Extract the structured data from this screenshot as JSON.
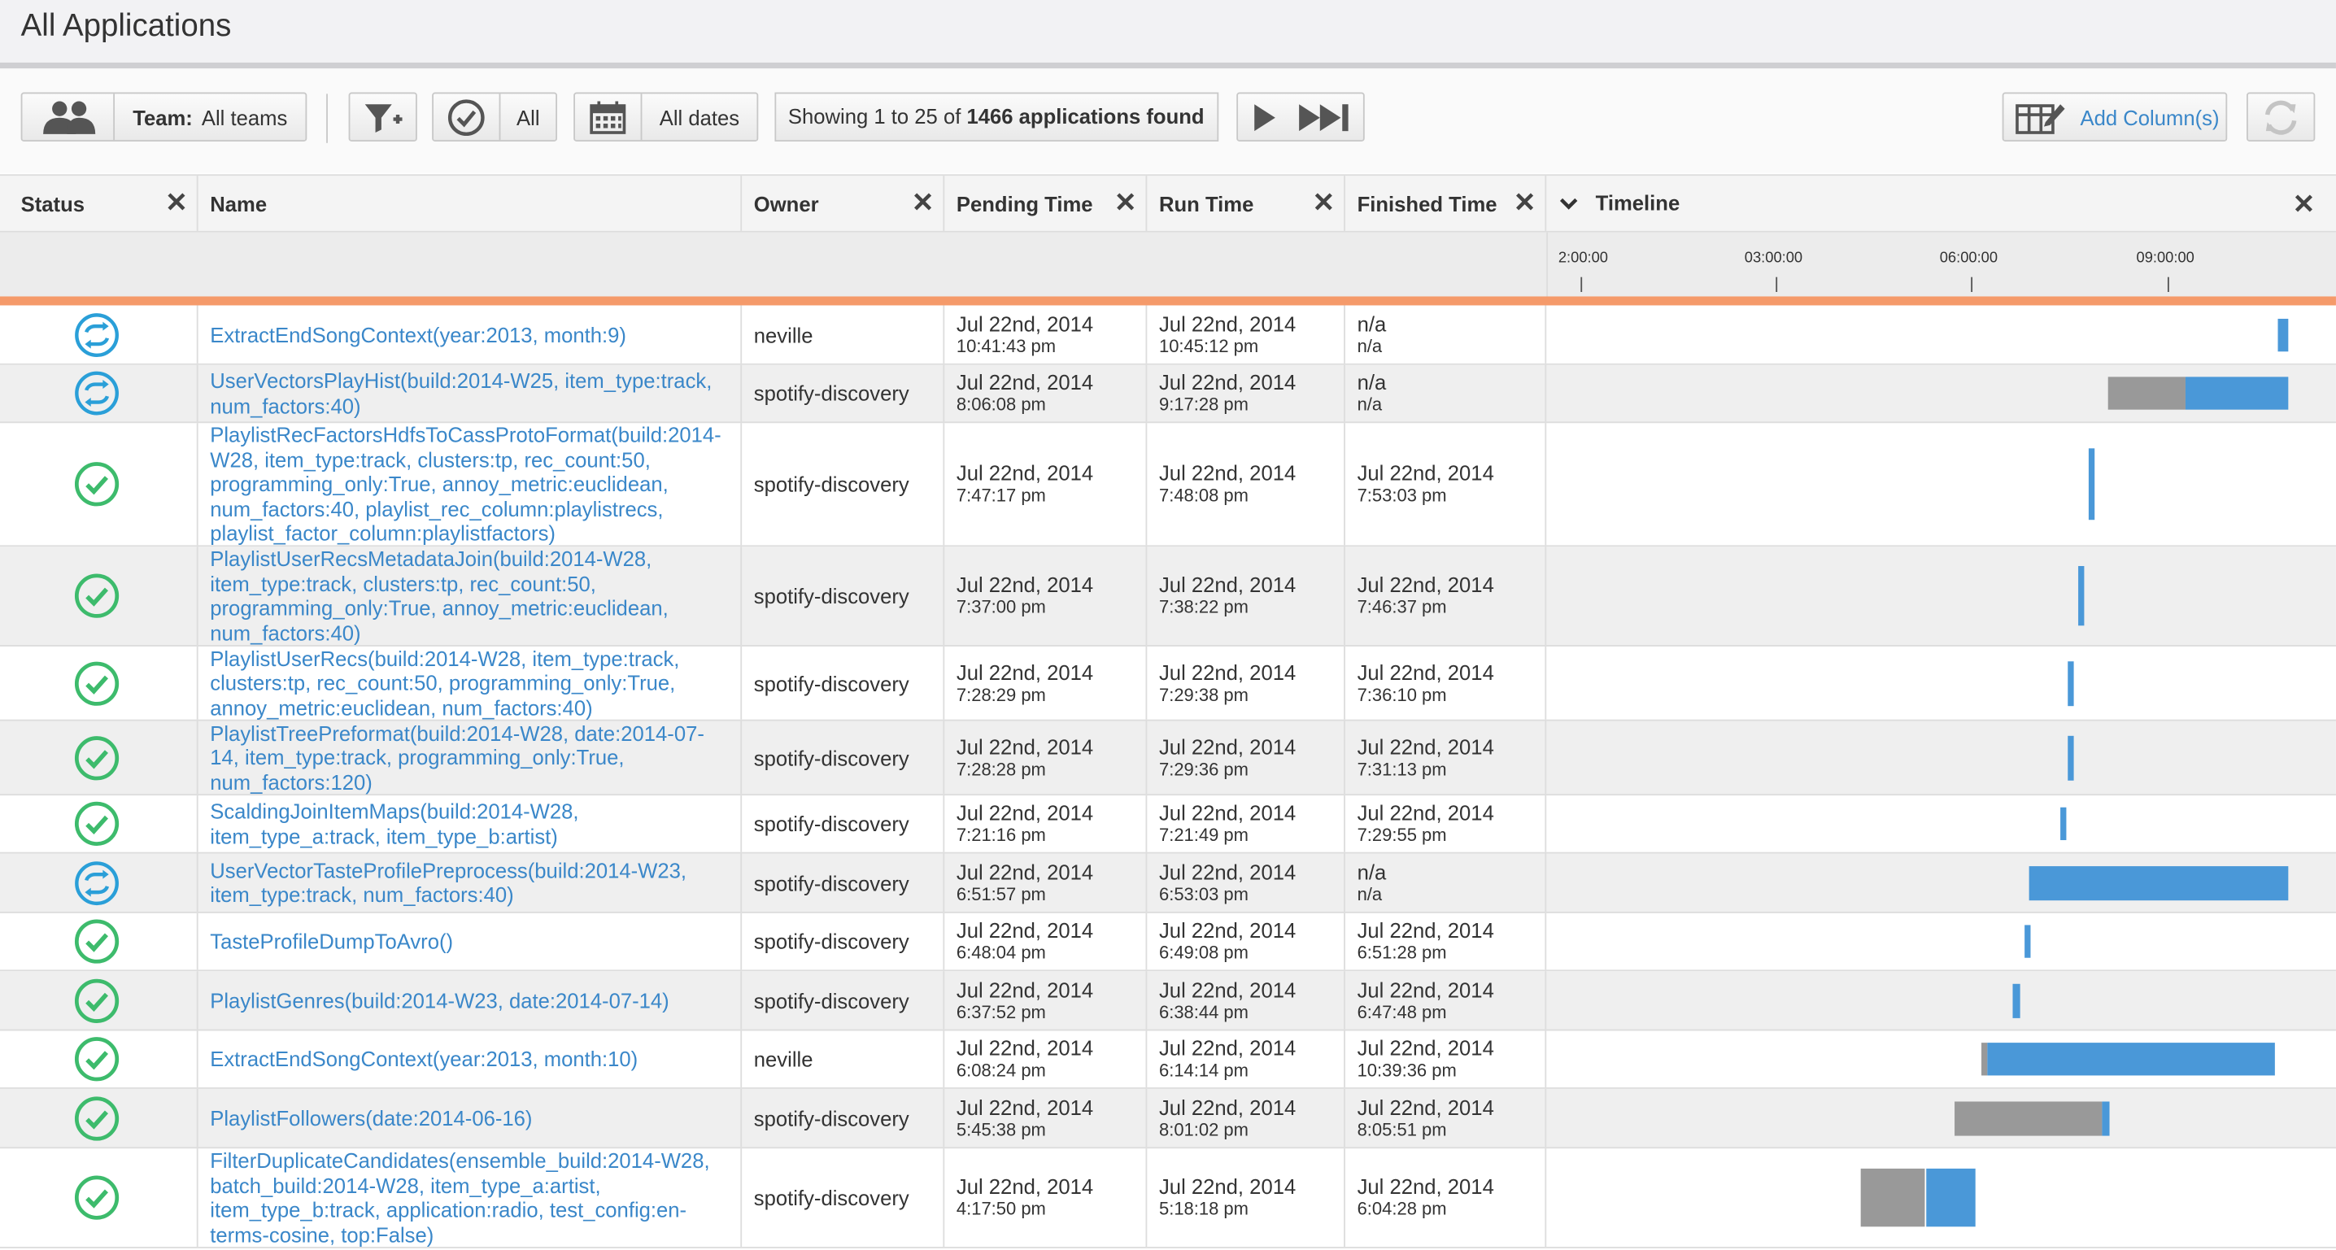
{
  "page": {
    "title": "All Applications"
  },
  "toolbar": {
    "team_label": "Team:",
    "team_value": "All teams",
    "status_filter": "All",
    "date_filter": "All dates",
    "showing_prefix": "Showing 1 to 25 of",
    "showing_count": "1466 applications found",
    "add_columns": "Add Column(s)"
  },
  "columns": {
    "status": "Status",
    "name": "Name",
    "owner": "Owner",
    "pending": "Pending Time",
    "run": "Run Time",
    "finished": "Finished Time",
    "timeline": "Timeline"
  },
  "timeline_ticks": [
    "2:00:00",
    "03:00:00",
    "06:00:00",
    "09:00:00"
  ],
  "colors": {
    "link": "#3a87c9",
    "running": "#2a9fd8",
    "succeeded": "#3dbb6c",
    "bar_run": "#4a98d8",
    "bar_pending": "#999999",
    "accent_orange": "#f59a6a"
  },
  "rows": [
    {
      "status": "running",
      "name": "ExtractEndSongContext(year:2013, month:9)",
      "owner": "neville",
      "pending_date": "Jul 22nd, 2014",
      "pending_time": "10:41:43 pm",
      "run_date": "Jul 22nd, 2014",
      "run_time": "10:45:12 pm",
      "fin_date": "n/a",
      "fin_time": "n/a"
    },
    {
      "status": "running",
      "name": "UserVectorsPlayHist(build:2014-W25, item_type:track, num_factors:40)",
      "owner": "spotify-discovery",
      "pending_date": "Jul 22nd, 2014",
      "pending_time": "8:06:08 pm",
      "run_date": "Jul 22nd, 2014",
      "run_time": "9:17:28 pm",
      "fin_date": "n/a",
      "fin_time": "n/a"
    },
    {
      "status": "succeeded",
      "name": "PlaylistRecFactorsHdfsToCassProtoFormat(build:2014-W28, item_type:track, clusters:tp, rec_count:50, programming_only:True, annoy_metric:euclidean, num_factors:40, playlist_rec_column:playlistrecs, playlist_factor_column:playlistfactors)",
      "owner": "spotify-discovery",
      "pending_date": "Jul 22nd, 2014",
      "pending_time": "7:47:17 pm",
      "run_date": "Jul 22nd, 2014",
      "run_time": "7:48:08 pm",
      "fin_date": "Jul 22nd, 2014",
      "fin_time": "7:53:03 pm"
    },
    {
      "status": "succeeded",
      "name": "PlaylistUserRecsMetadataJoin(build:2014-W28, item_type:track, clusters:tp, rec_count:50, programming_only:True, annoy_metric:euclidean, num_factors:40)",
      "owner": "spotify-discovery",
      "pending_date": "Jul 22nd, 2014",
      "pending_time": "7:37:00 pm",
      "run_date": "Jul 22nd, 2014",
      "run_time": "7:38:22 pm",
      "fin_date": "Jul 22nd, 2014",
      "fin_time": "7:46:37 pm"
    },
    {
      "status": "succeeded",
      "name": "PlaylistUserRecs(build:2014-W28, item_type:track, clusters:tp, rec_count:50, programming_only:True, annoy_metric:euclidean, num_factors:40)",
      "owner": "spotify-discovery",
      "pending_date": "Jul 22nd, 2014",
      "pending_time": "7:28:29 pm",
      "run_date": "Jul 22nd, 2014",
      "run_time": "7:29:38 pm",
      "fin_date": "Jul 22nd, 2014",
      "fin_time": "7:36:10 pm"
    },
    {
      "status": "succeeded",
      "name": "PlaylistTreePreformat(build:2014-W28, date:2014-07-14, item_type:track, programming_only:True, num_factors:120)",
      "owner": "spotify-discovery",
      "pending_date": "Jul 22nd, 2014",
      "pending_time": "7:28:28 pm",
      "run_date": "Jul 22nd, 2014",
      "run_time": "7:29:36 pm",
      "fin_date": "Jul 22nd, 2014",
      "fin_time": "7:31:13 pm"
    },
    {
      "status": "succeeded",
      "name": "ScaldingJoinItemMaps(build:2014-W28, item_type_a:track, item_type_b:artist)",
      "owner": "spotify-discovery",
      "pending_date": "Jul 22nd, 2014",
      "pending_time": "7:21:16 pm",
      "run_date": "Jul 22nd, 2014",
      "run_time": "7:21:49 pm",
      "fin_date": "Jul 22nd, 2014",
      "fin_time": "7:29:55 pm"
    },
    {
      "status": "running",
      "name": "UserVectorTasteProfilePreprocess(build:2014-W23, item_type:track, num_factors:40)",
      "owner": "spotify-discovery",
      "pending_date": "Jul 22nd, 2014",
      "pending_time": "6:51:57 pm",
      "run_date": "Jul 22nd, 2014",
      "run_time": "6:53:03 pm",
      "fin_date": "n/a",
      "fin_time": "n/a"
    },
    {
      "status": "succeeded",
      "name": "TasteProfileDumpToAvro()",
      "owner": "spotify-discovery",
      "pending_date": "Jul 22nd, 2014",
      "pending_time": "6:48:04 pm",
      "run_date": "Jul 22nd, 2014",
      "run_time": "6:49:08 pm",
      "fin_date": "Jul 22nd, 2014",
      "fin_time": "6:51:28 pm"
    },
    {
      "status": "succeeded",
      "name": "PlaylistGenres(build:2014-W23, date:2014-07-14)",
      "owner": "spotify-discovery",
      "pending_date": "Jul 22nd, 2014",
      "pending_time": "6:37:52 pm",
      "run_date": "Jul 22nd, 2014",
      "run_time": "6:38:44 pm",
      "fin_date": "Jul 22nd, 2014",
      "fin_time": "6:47:48 pm"
    },
    {
      "status": "succeeded",
      "name": "ExtractEndSongContext(year:2013, month:10)",
      "owner": "neville",
      "pending_date": "Jul 22nd, 2014",
      "pending_time": "6:08:24 pm",
      "run_date": "Jul 22nd, 2014",
      "run_time": "6:14:14 pm",
      "fin_date": "Jul 22nd, 2014",
      "fin_time": "10:39:36 pm"
    },
    {
      "status": "succeeded",
      "name": "PlaylistFollowers(date:2014-06-16)",
      "owner": "spotify-discovery",
      "pending_date": "Jul 22nd, 2014",
      "pending_time": "5:45:38 pm",
      "run_date": "Jul 22nd, 2014",
      "run_time": "8:01:02 pm",
      "fin_date": "Jul 22nd, 2014",
      "fin_time": "8:05:51 pm"
    },
    {
      "status": "succeeded",
      "name": "FilterDuplicateCandidates(ensemble_build:2014-W28, batch_build:2014-W28, item_type_a:artist, item_type_b:track, application:radio, test_config:en-terms-cosine, top:False)",
      "owner": "spotify-discovery",
      "pending_date": "Jul 22nd, 2014",
      "pending_time": "4:17:50 pm",
      "run_date": "Jul 22nd, 2014",
      "run_time": "5:18:18 pm",
      "fin_date": "Jul 22nd, 2014",
      "fin_time": "6:04:28 pm"
    }
  ]
}
